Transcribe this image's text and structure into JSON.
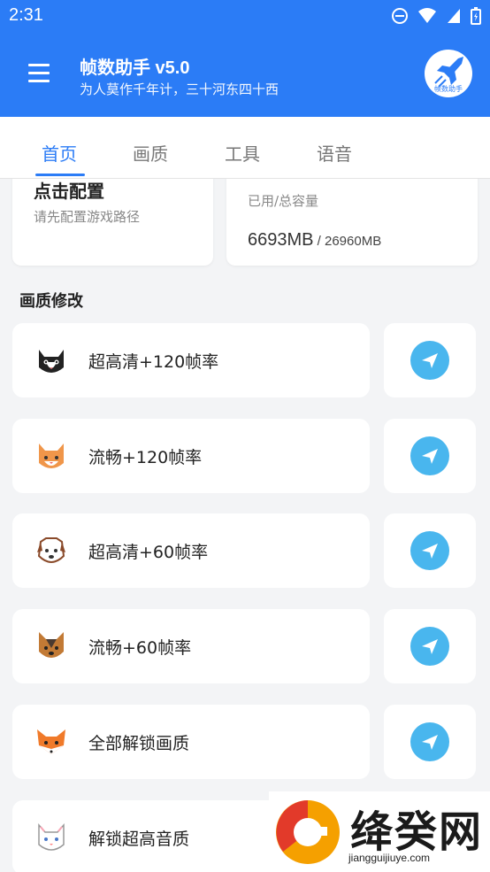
{
  "status_bar": {
    "time": "2:31"
  },
  "app_bar": {
    "title": "帧数助手 v5.0",
    "subtitle": "为人莫作千年计，三十河东四十西",
    "logo_caption": "帧数助手"
  },
  "tabs": [
    {
      "label": "首页",
      "active": true
    },
    {
      "label": "画质",
      "active": false
    },
    {
      "label": "工具",
      "active": false
    },
    {
      "label": "语音",
      "active": false
    }
  ],
  "config_card": {
    "title": "点击配置",
    "subtitle": "请先配置游戏路径"
  },
  "storage_card": {
    "label": "已用/总容量",
    "used": "6693MB",
    "total": " / 26960MB"
  },
  "section": {
    "title": "画质修改"
  },
  "options": [
    {
      "label": "超高清+120帧率",
      "icon": "cat-black-white-icon"
    },
    {
      "label": "流畅+120帧率",
      "icon": "cat-orange-icon"
    },
    {
      "label": "超高清+60帧率",
      "icon": "dog-brown-icon"
    },
    {
      "label": "流畅+60帧率",
      "icon": "dog-yorkie-icon"
    },
    {
      "label": "全部解锁画质",
      "icon": "fox-icon"
    },
    {
      "label": "解锁超高音质",
      "icon": "cat-white-icon"
    }
  ],
  "watermark": {
    "text": "绛癸网",
    "url": "jiangguijiuye.com"
  },
  "colors": {
    "primary": "#2b7cf6",
    "send_button": "#49b6ee",
    "background": "#f3f4f6"
  }
}
